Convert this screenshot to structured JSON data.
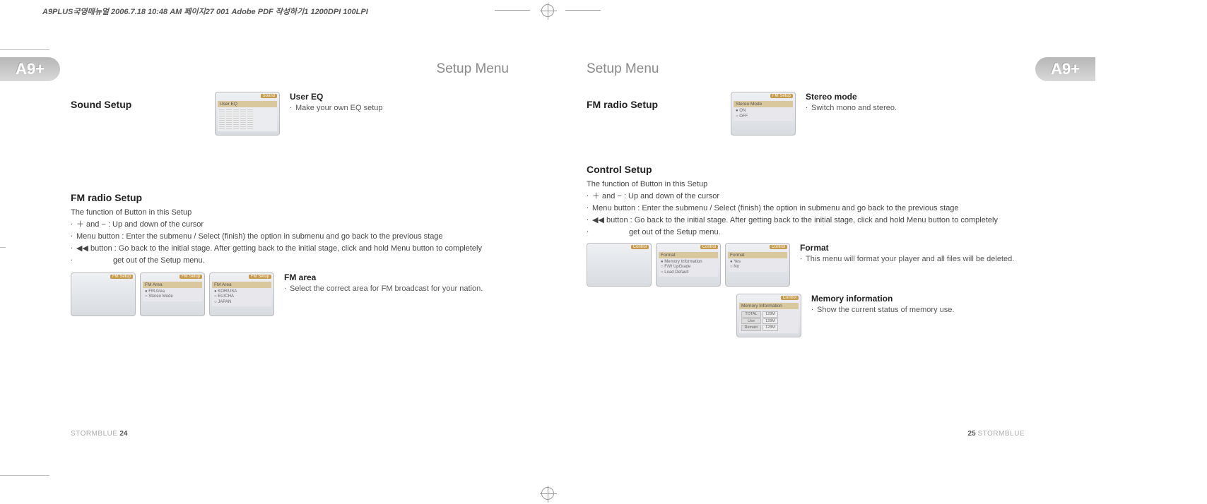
{
  "print_meta": "A9PLUS국영매뉴얼  2006.7.18 10:48 AM  페이지27   001 Adobe PDF 작성하기1 1200DPI 100LPI",
  "brand_badge": "A9+",
  "page_title": "Setup Menu",
  "left": {
    "sound_setup": {
      "title": "Sound Setup",
      "user_eq": {
        "title": "User EQ",
        "desc": "Make your own EQ setup"
      },
      "shot_eq": {
        "label": "User EQ",
        "tab": "Sound"
      }
    },
    "fm_radio_setup": {
      "title": "FM radio Setup",
      "intro": "The function of Button in this Setup",
      "line1": "＋ and  − : Up and down of the cursor",
      "line2": "Menu button : Enter the submenu / Select (finish) the option in submenu and go back to the previous stage",
      "line3a": "◀◀ button : Go back to the initial stage. After getting back to the initial stage, click and hold Menu button to completely",
      "line3b": "get out of the Setup menu.",
      "fm_area": {
        "title": "FM area",
        "desc": "Select the correct area for FM broadcast for your nation."
      },
      "shot1": {
        "tab": "FM Setup"
      },
      "shot2": {
        "tab": "FM Setup",
        "hdr": "FM Area",
        "opt1": "FM Area",
        "opt2": "Stereo Mode"
      },
      "shot3": {
        "tab": "FM Setup",
        "hdr": "FM Area",
        "opt1": "KOR/USA",
        "opt2": "EU/CHA",
        "opt3": "JAPAN"
      }
    },
    "footer": {
      "brand": "STORMBLUE",
      "page": "24"
    }
  },
  "right": {
    "fm_radio_setup": {
      "title": "FM radio Setup",
      "stereo_mode": {
        "title": "Stereo mode",
        "desc": "Switch mono and stereo."
      },
      "shot": {
        "tab": "FM Setup",
        "hdr": "Stereo Mode",
        "opt1": "ON",
        "opt2": "OFF"
      }
    },
    "control_setup": {
      "title": "Control Setup",
      "intro": "The function of Button in this Setup",
      "line1": "＋ and  − : Up and down of the cursor",
      "line2": "Menu button : Enter the submenu / Select (finish) the option in submenu and go back to the previous stage",
      "line3a": "◀◀ button : Go back to the initial stage. After getting back to the initial stage, click and hold Menu button to completely",
      "line3b": "get out of the Setup menu.",
      "format": {
        "title": "Format",
        "desc": "This menu will format your player and all files will be deleted."
      },
      "memory_info": {
        "title": "Memory information",
        "desc": "Show the current status of memory use."
      },
      "shot1": {
        "tab": "Control"
      },
      "shot2": {
        "tab": "Control",
        "hdr": "Format",
        "opt1": "Memory Information",
        "opt2": "F/W UpGrade",
        "opt3": "Load Default"
      },
      "shot3": {
        "tab": "Control",
        "hdr": "Format",
        "opt1": "Yes",
        "opt2": "No"
      },
      "shot_mem": {
        "tab": "Control",
        "hdr": "Memory Information",
        "rows": [
          {
            "k": "TOTAL",
            "v": "128M"
          },
          {
            "k": "Use",
            "v": "128M"
          },
          {
            "k": "Remain",
            "v": "128M"
          }
        ]
      }
    },
    "footer": {
      "brand": "STORMBLUE",
      "page": "25"
    }
  }
}
